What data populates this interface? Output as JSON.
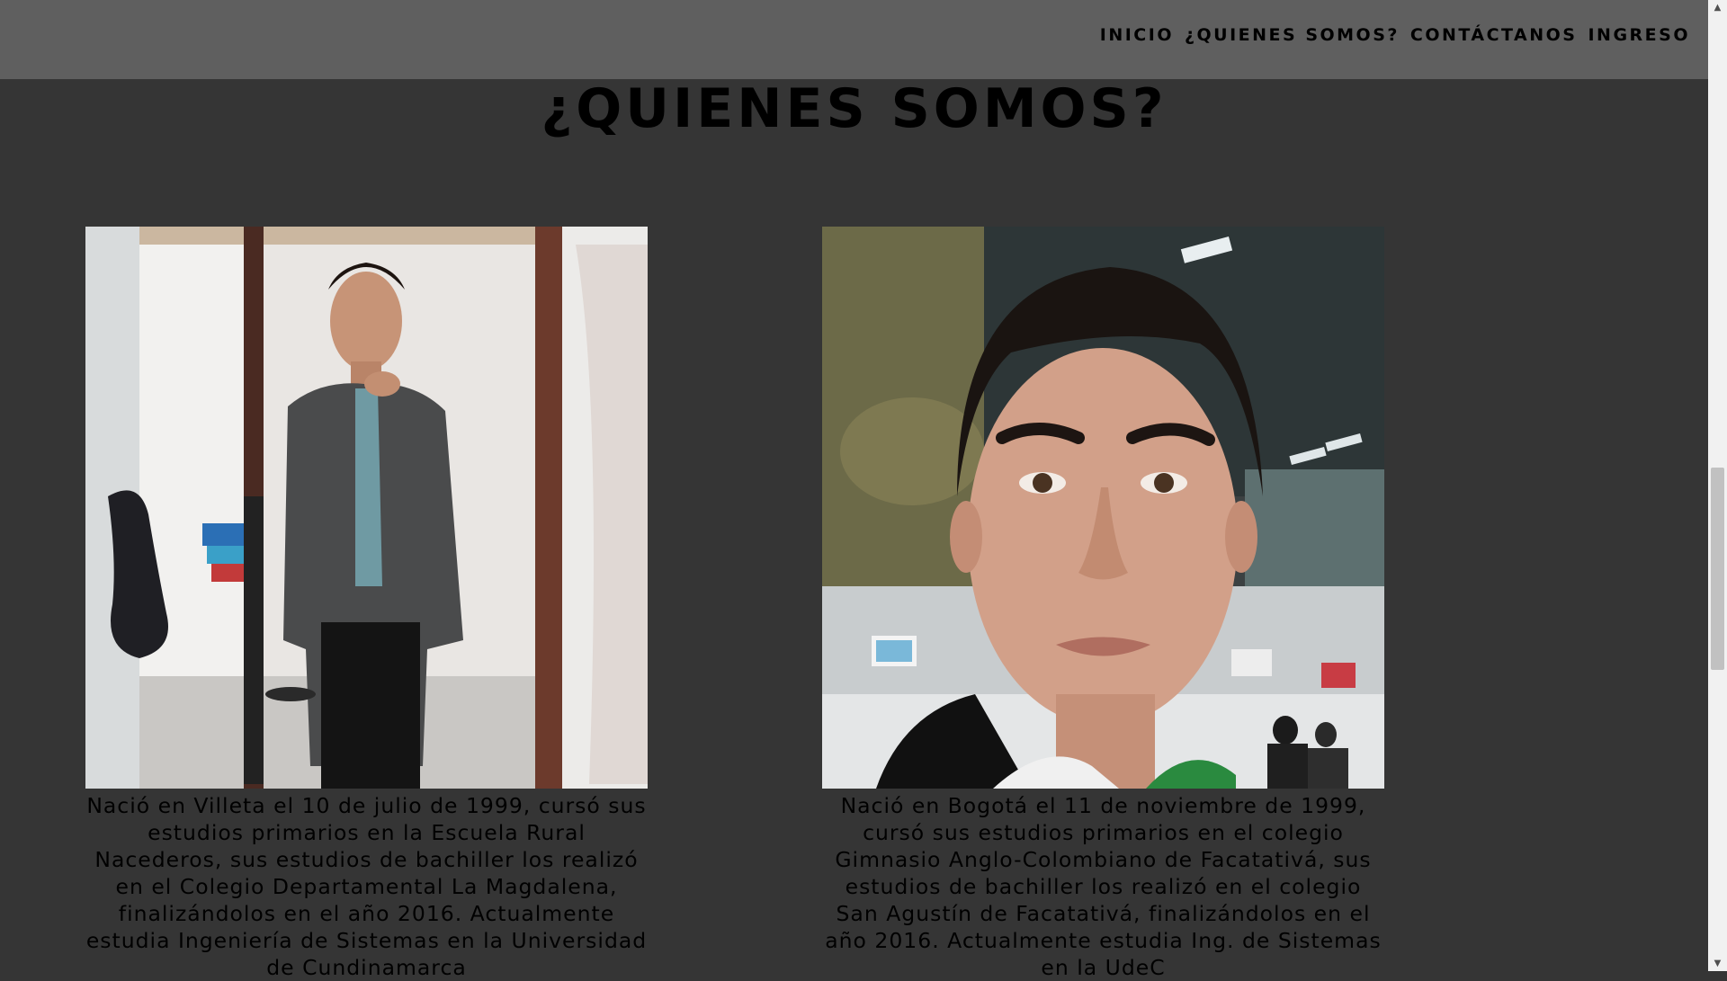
{
  "nav": {
    "items": [
      {
        "label": "INICIO"
      },
      {
        "label": "¿QUIENES SOMOS?"
      },
      {
        "label": "CONTÁCTANOS"
      },
      {
        "label": "INGRESO"
      }
    ]
  },
  "section": {
    "title": "¿QUIENES SOMOS?"
  },
  "profiles": [
    {
      "bio": "Nació en Villeta el 10 de julio de 1999, cursó sus estudios primarios en la Escuela Rural Nacederos, sus estudios de bachiller los realizó en el Colegio Departamental La Magdalena, finalizándolos en el año 2016. Actualmente estudia Ingeniería de Sistemas en la Universidad de Cundinamarca"
    },
    {
      "bio": "Nació en Bogotá el 11 de noviembre de 1999, cursó sus estudios primarios en el colegio Gimnasio Anglo-Colombiano de Facatativá, sus estudios de bachiller los realizó en el colegio San Agustín de Facatativá, finalizándolos en el año 2016. Actualmente estudia Ing. de Sistemas en la UdeC"
    }
  ],
  "scrollbar": {
    "up_icon": "▲",
    "down_icon": "▼"
  }
}
